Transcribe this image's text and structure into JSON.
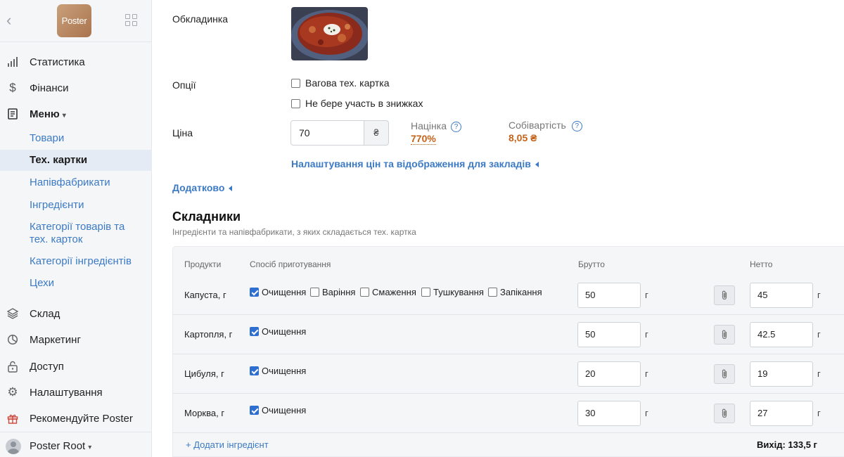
{
  "sidebar": {
    "logo_text": "Poster",
    "items": [
      {
        "label": "Статистика",
        "icon": "bar-chart-icon"
      },
      {
        "label": "Фінанси",
        "icon": "dollar-icon"
      },
      {
        "label": "Меню",
        "icon": "document-icon"
      },
      {
        "label": "Склад",
        "icon": "layers-icon"
      },
      {
        "label": "Маркетинг",
        "icon": "pie-icon"
      },
      {
        "label": "Доступ",
        "icon": "lock-icon"
      },
      {
        "label": "Налаштування",
        "icon": "gear-icon"
      },
      {
        "label": "Рекомендуйте Poster",
        "icon": "gift-icon"
      }
    ],
    "menu_caret": "▾",
    "sub_items": [
      "Товари",
      "Тех. картки",
      "Напівфабрикати",
      "Інгредієнти",
      "Категорії товарів та тех. карток",
      "Категорії інгредієнтів",
      "Цехи"
    ],
    "active_sub": "Тех. картки",
    "user": "Poster Root",
    "user_caret": "▾"
  },
  "form": {
    "cover_label": "Обкладинка",
    "options_label": "Опції",
    "option_weight": "Вагова тех. картка",
    "option_discount": "Не бере участь в знижках",
    "price_label": "Ціна",
    "price_value": "70",
    "currency": "₴",
    "markup_label": "Націнка",
    "markup_value": "770%",
    "cost_label": "Собівартість",
    "cost_value": "8,05 ₴",
    "help_glyph": "?",
    "price_settings_link": "Налаштування цін та відображення для закладів",
    "additional_link": "Додатково"
  },
  "ingredients": {
    "title": "Складники",
    "subtitle": "Інгредієнти та напівфабрикати, з яких складається тех. картка",
    "headers": {
      "product": "Продукти",
      "method": "Спосіб приготування",
      "gross": "Брутто",
      "net": "Нетто"
    },
    "unit": "г",
    "rows": [
      {
        "product": "Капуста, г",
        "methods": [
          {
            "label": "Очищення",
            "checked": true
          },
          {
            "label": "Варіння",
            "checked": false
          },
          {
            "label": "Смаження",
            "checked": false
          },
          {
            "label": "Тушкування",
            "checked": false
          },
          {
            "label": "Запікання",
            "checked": false
          }
        ],
        "gross": "50",
        "net": "45"
      },
      {
        "product": "Картопля, г",
        "methods": [
          {
            "label": "Очищення",
            "checked": true
          }
        ],
        "gross": "50",
        "net": "42.5"
      },
      {
        "product": "Цибуля, г",
        "methods": [
          {
            "label": "Очищення",
            "checked": true
          }
        ],
        "gross": "20",
        "net": "19"
      },
      {
        "product": "Морква, г",
        "methods": [
          {
            "label": "Очищення",
            "checked": true
          }
        ],
        "gross": "30",
        "net": "27"
      }
    ],
    "add_link": "+ Додати інгредієнт",
    "output": "Вихід: 133,5 г"
  }
}
